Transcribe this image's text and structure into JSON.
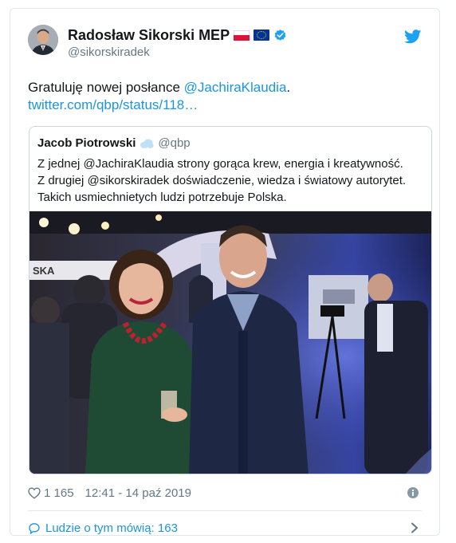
{
  "author": {
    "display_name": "Radosław Sikorski MEP",
    "handle": "@sikorskiradek"
  },
  "tweet": {
    "text_prefix": "Gratuluję nowej posłance ",
    "mention": "@JachiraKlaudia",
    "text_suffix": ".",
    "link": "twitter.com/qbp/status/118…"
  },
  "quoted_tweet": {
    "display_name": "Jacob Piotrowski",
    "handle": "@qbp",
    "lines": [
      "Z jednej @JachiraKlaudia strony gorąca krew, energia i kreatywność.",
      "Z drugiej @sikorskiradek doświadczenie, wiedza i światowy autorytet.",
      "Takich usmiechnietych ludzi potrzebuje Polska."
    ]
  },
  "meta": {
    "likes": "1 165",
    "timestamp": "12:41 - 14 paź 2019"
  },
  "footer": {
    "conversation_label": "Ludzie o tym mówią: 163"
  },
  "icons": [
    "flag-pl-icon",
    "flag-eu-icon",
    "verified-icon",
    "twitter-bird-icon",
    "heart-icon",
    "info-icon",
    "comment-bubble-icon",
    "chevron-right-icon"
  ],
  "colors": {
    "link": "#1b95e0",
    "muted": "#657786",
    "text": "#14171a",
    "border": "#e1e8ed"
  }
}
